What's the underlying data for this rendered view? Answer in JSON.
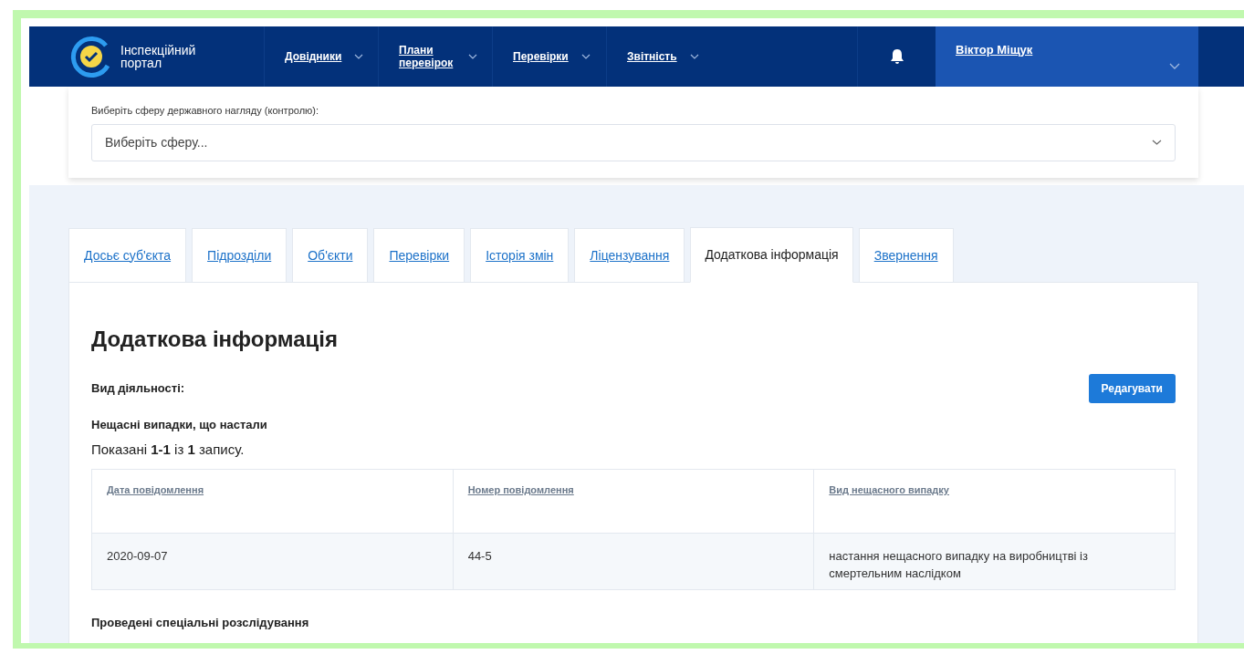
{
  "header": {
    "logo_lines": [
      "Інспекційний",
      "портал"
    ],
    "nav": [
      {
        "label": "Довідники"
      },
      {
        "label": "Плани перевірок"
      },
      {
        "label": "Перевірки"
      },
      {
        "label": "Звітність"
      }
    ],
    "user": {
      "name": "Віктор Міщук"
    }
  },
  "sphere_select": {
    "label": "Виберіть сферу державного нагляду (контролю):",
    "placeholder": "Виберіть сферу..."
  },
  "tabs": [
    {
      "label": "Досьє суб'єкта",
      "selected": false
    },
    {
      "label": "Підрозділи",
      "selected": false
    },
    {
      "label": "Об'єкти",
      "selected": false
    },
    {
      "label": "Перевірки",
      "selected": false
    },
    {
      "label": "Історія змін",
      "selected": false
    },
    {
      "label": "Ліцензування",
      "selected": false
    },
    {
      "label": "Додаткова інформація",
      "selected": true
    },
    {
      "label": "Звернення",
      "selected": false
    }
  ],
  "content": {
    "title": "Додаткова інформація",
    "activity_label": "Вид діяльності:",
    "edit_button": "Редагувати",
    "accidents": {
      "title": "Нещасні випадки, що настали",
      "summary": "Показані **1-1** із **1** запису.",
      "columns": [
        "Дата повідомлення",
        "Номер повідомлення",
        "Вид нещасного випадку"
      ],
      "rows": [
        [
          "2020-09-07",
          "44-5",
          "настання нещасного випадку на виробництві із смертельним наслідком"
        ]
      ]
    },
    "next_section_title": "Проведені спеціальні розслідування"
  }
}
